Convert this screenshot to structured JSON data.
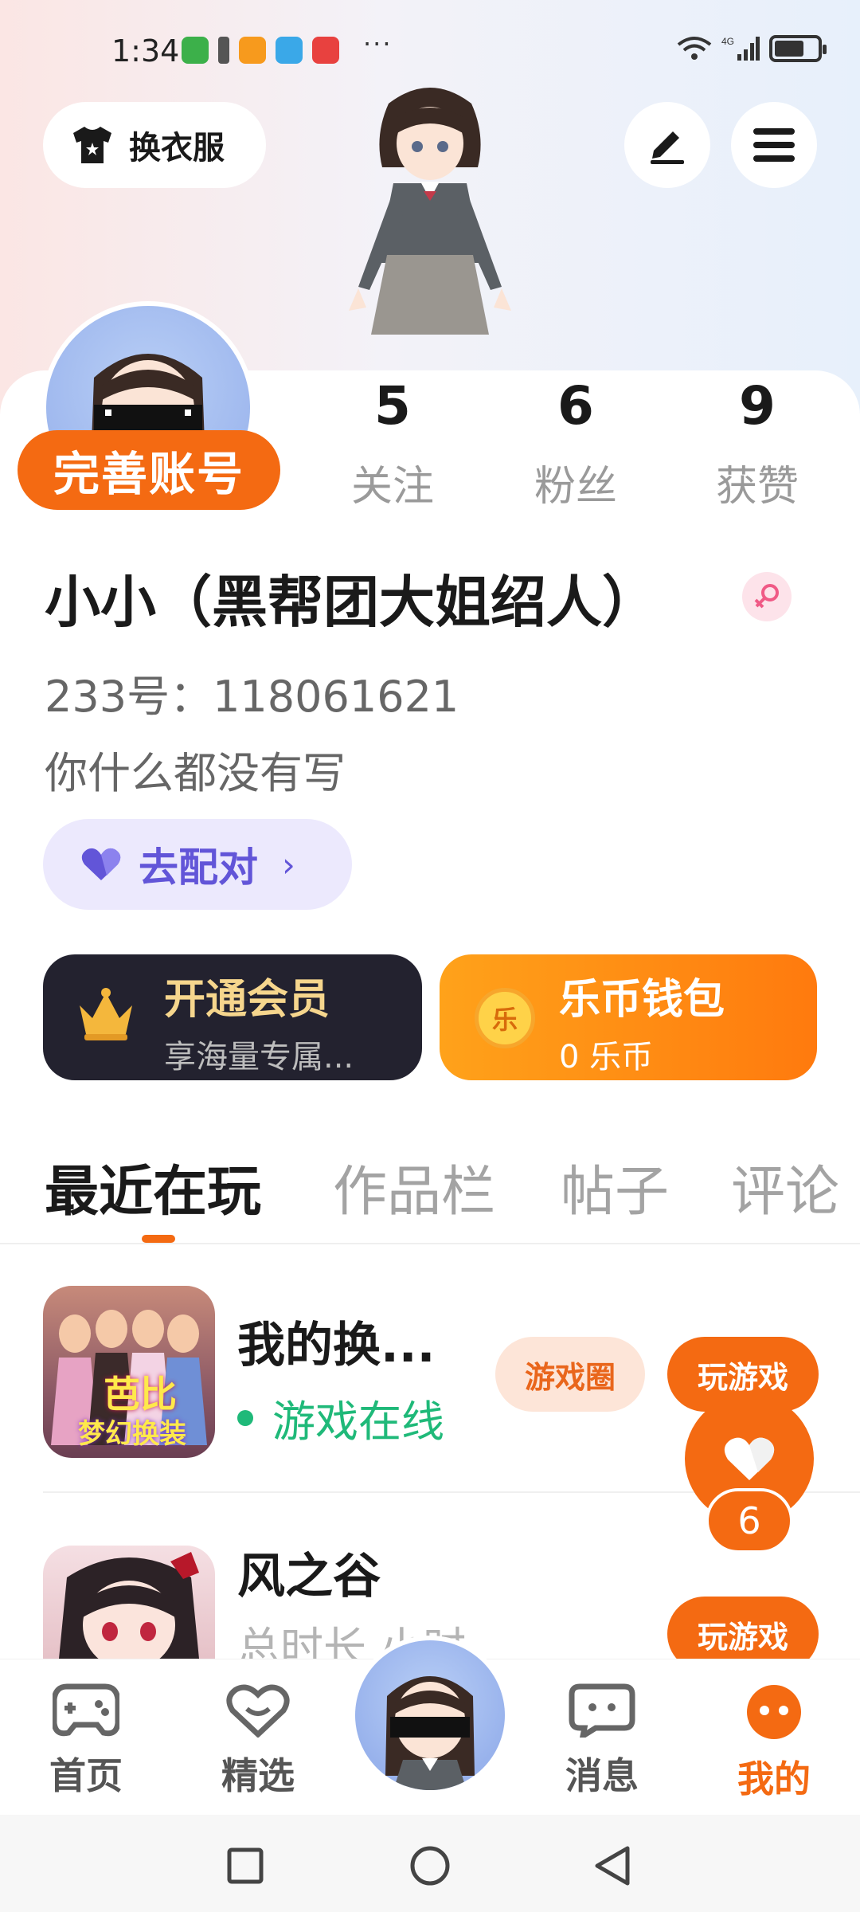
{
  "status_bar": {
    "time": "1:34",
    "more": "···",
    "battery_level": 0.7
  },
  "header": {
    "outfit_label": "换衣服",
    "edit_icon": "pen-icon",
    "menu_icon": "hamburger-menu-icon"
  },
  "profile": {
    "complete_label": "完善账号",
    "stats": [
      {
        "value": "5",
        "label": "关注"
      },
      {
        "value": "6",
        "label": "粉丝"
      },
      {
        "value": "9",
        "label": "获赞"
      }
    ],
    "name": "小小（黑帮团大姐绍人）",
    "gender": "female",
    "uid": "233号：118061621",
    "bio": "你什么都没有写",
    "match_label": "去配对",
    "match_chevron": "›"
  },
  "cards": {
    "vip_title": "开通会员",
    "vip_sub": "享海量专属...",
    "wallet_title": "乐币钱包",
    "wallet_sub": "0 乐币",
    "coin_glyph": "乐"
  },
  "tabs": [
    "最近在玩",
    "作品栏",
    "帖子",
    "评论"
  ],
  "games": [
    {
      "name": "我的换...",
      "status": "游戏在线",
      "thumb_text_1": "芭比",
      "thumb_text_2": "梦幻换装",
      "circle_label": "游戏圈",
      "play_label": "玩游戏"
    },
    {
      "name": "风之谷",
      "sub": "总时长    小时",
      "play_label": "玩游戏"
    }
  ],
  "float_like": {
    "count": "6"
  },
  "nav": [
    {
      "label": "首页"
    },
    {
      "label": "精选"
    },
    {
      "label": "消息"
    },
    {
      "label": "我的"
    }
  ],
  "colors": {
    "accent": "#f46a12",
    "match": "#6255d8",
    "online": "#1fb979"
  }
}
